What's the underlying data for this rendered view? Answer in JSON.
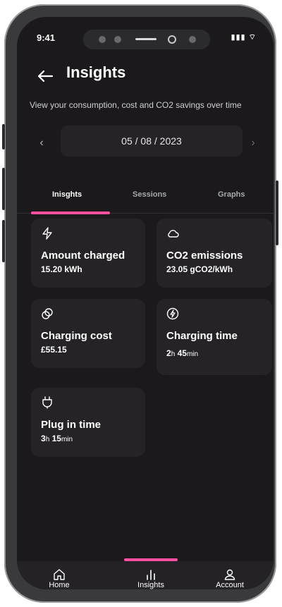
{
  "status": {
    "time": "9:41",
    "system": "▮▮▮ ⌔"
  },
  "header": {
    "title": "Insights",
    "subtitle": "View your consumption, cost and CO2 savings over time"
  },
  "date_selector": {
    "prev": "‹",
    "date": "05 / 08 / 2023",
    "next": "›"
  },
  "tabs": [
    {
      "label": "Inisghts",
      "active": true
    },
    {
      "label": "Sessions",
      "active": false
    },
    {
      "label": "Graphs",
      "active": false
    }
  ],
  "cards": [
    {
      "label": "Amount charged",
      "value": "15.20 kWh",
      "icon": "lightning-icon"
    },
    {
      "label": "CO2 emissions",
      "value": "23.05 gCO2/kWh",
      "icon": "cloud-icon"
    },
    {
      "label": "Charging cost",
      "value": "£55.15",
      "icon": "coins-icon"
    },
    {
      "label": "Charging time",
      "value_hours": "2",
      "value_h_unit": "h",
      "value_minutes": "45",
      "value_min_unit": "min",
      "icon": "charging-timer-icon"
    },
    {
      "label": "Plug in time",
      "value_hours": "3",
      "value_h_unit": "h",
      "value_minutes": "15",
      "value_min_unit": "min",
      "icon": "plug-icon"
    }
  ],
  "bottom_nav": [
    {
      "label": "Home",
      "icon": "home-icon"
    },
    {
      "label": "Insights",
      "icon": "bar-chart-icon",
      "active": true
    },
    {
      "label": "Account",
      "icon": "user-icon"
    }
  ],
  "colors": {
    "accent": "#ff4fa0",
    "background": "#1b191b",
    "card": "#262327"
  }
}
